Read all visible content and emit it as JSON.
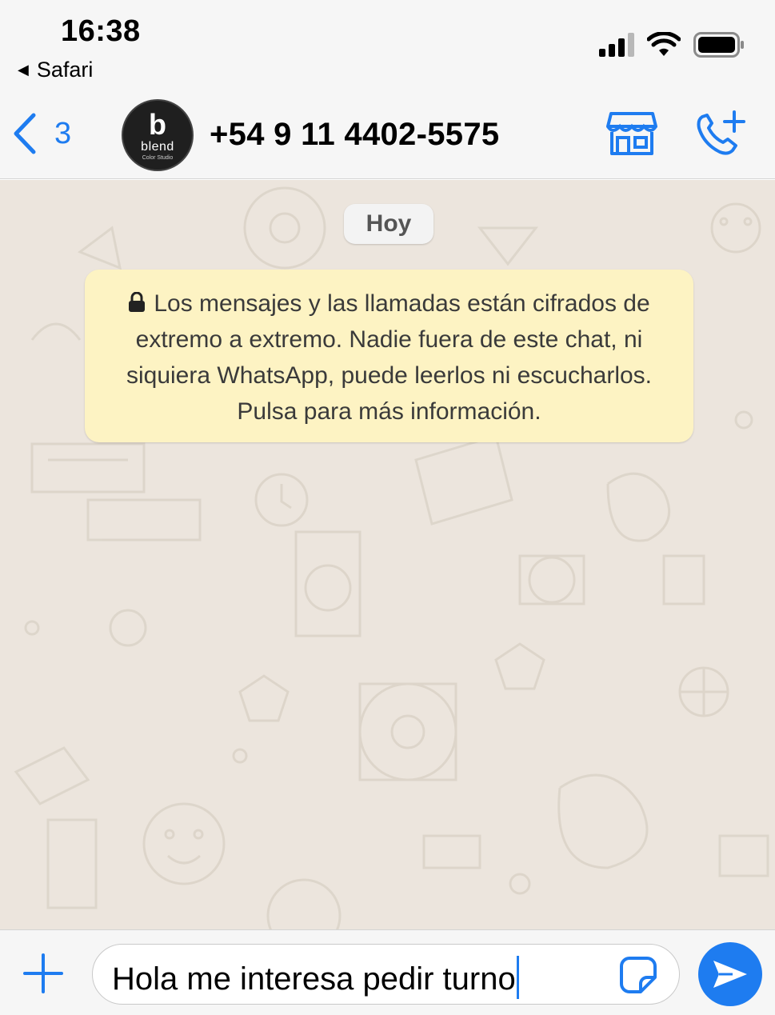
{
  "status_bar": {
    "time": "16:38",
    "back_app": "Safari",
    "icons": [
      "signal-icon",
      "wifi-icon",
      "battery-icon"
    ]
  },
  "header": {
    "back_count": "3",
    "contact_name": "+54 9 11 4402-5575",
    "avatar": {
      "logo_letter": "b",
      "logo_word": "blend",
      "logo_sub": "Color Studio"
    },
    "icons": [
      "chevron-left-icon",
      "shop-icon",
      "call-add-icon"
    ]
  },
  "chat": {
    "date_label": "Hoy",
    "encryption_notice": "Los mensajes y las llamadas están cifrados de extremo a extremo. Nadie fuera de este chat, ni siquiera WhatsApp, puede leerlos ni escucharlos. Pulsa para más información."
  },
  "composer": {
    "value": "Hola me interesa pedir turno",
    "icons": [
      "plus-icon",
      "sticker-icon",
      "send-icon"
    ]
  },
  "colors": {
    "accent": "#1e7cf0",
    "chat_background": "#ece5dd",
    "notice_background": "#fdf3c3",
    "bar_background": "#f6f6f6"
  }
}
